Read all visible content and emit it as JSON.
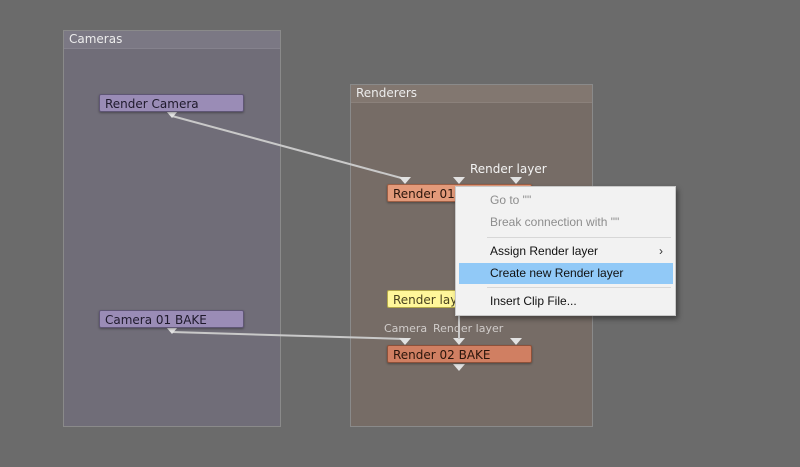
{
  "groups": {
    "cameras": {
      "title": "Cameras"
    },
    "renderers": {
      "title": "Renderers"
    }
  },
  "nodes": {
    "render_camera": "Render Camera",
    "camera_bake": "Camera 01 BAKE",
    "render_01": "Render 01",
    "render_layer_node": "Render layer",
    "render_02_bake": "Render 02 BAKE"
  },
  "ports": {
    "render01_render_layer": "Render layer",
    "render02_camera": "Camera",
    "render02_render_layer": "Render layer"
  },
  "context_menu": {
    "goto": "Go to \"\"",
    "break_connection": "Break connection with \"\"",
    "assign_render_layer": "Assign Render layer",
    "create_new_render_layer": "Create new Render layer",
    "insert_clip_file": "Insert Clip File...",
    "submenu_arrow": "›"
  },
  "colors": {
    "background": "#6b6b6b",
    "cameras_group": "#706d78",
    "renderers_group": "#766c66",
    "camera_node": "#9a8cb6",
    "renderer_node": "#e39a7a",
    "render_layer_node": "#fff79a",
    "menu_highlight": "#91c9f7"
  }
}
